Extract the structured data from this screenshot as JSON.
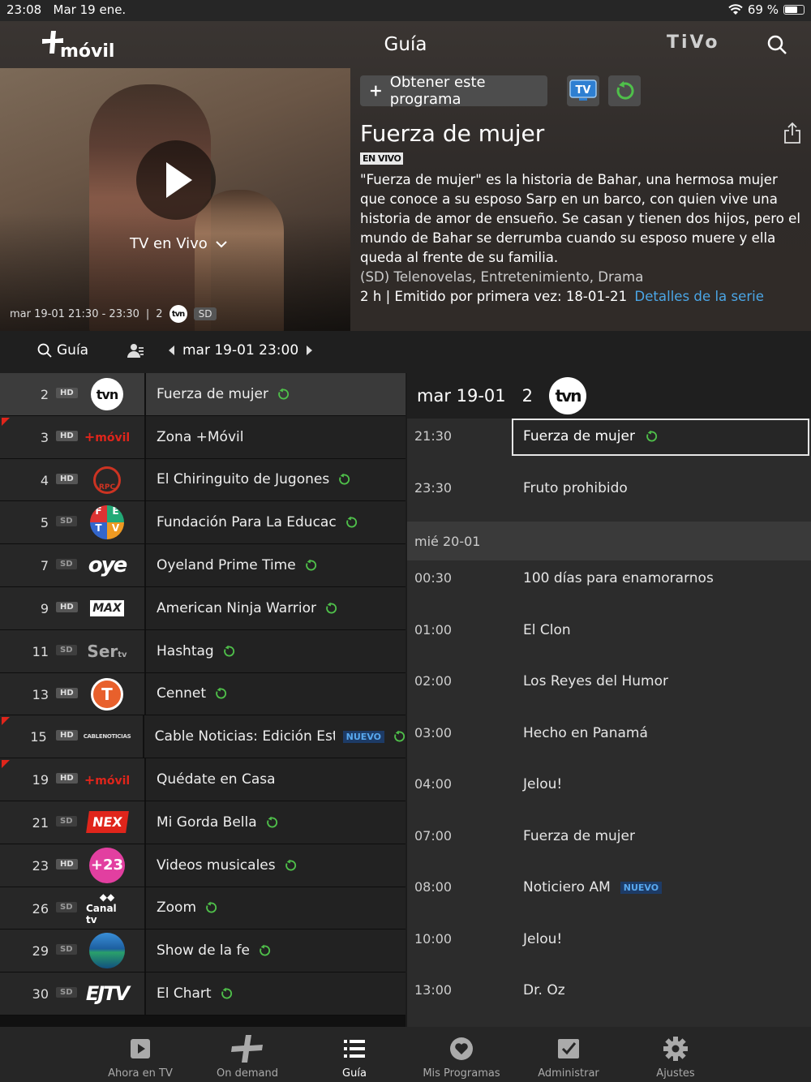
{
  "status_bar": {
    "time": "23:08",
    "date": "Mar 19 ene.",
    "battery": "69 %",
    "battery_level": 0.69
  },
  "header": {
    "logo_text": "+móvil",
    "title": "Guía",
    "brand": "TiVo"
  },
  "hero": {
    "play_label": "TV en Vivo",
    "airtime": "mar 19-01 21:30 - 23:30",
    "channel": "2",
    "channel_logo": "tvn",
    "quality": "SD"
  },
  "program": {
    "get_button": "Obtener este programa",
    "tv_button": "TV",
    "title": "Fuerza de mujer",
    "live_tag": "EN VIVO",
    "description": "\"Fuerza de mujer\" es la historia de Bahar, una hermosa mujer que conoce a su esposo Sarp en un barco, con quien vive una historia de amor de ensueño. Se casan y tienen dos hijos, pero el mundo de Bahar se derrumba cuando su esposo muere y ella queda al frente de su familia.",
    "genres": "(SD) Telenovelas, Entretenimiento, Drama",
    "meta": "2 h | Emitido por primera vez: 18-01-21",
    "series_link": "Detalles de la serie"
  },
  "filter": {
    "guide_label": "Guía",
    "date": "mar 19-01 23:00"
  },
  "channels": [
    {
      "num": "2",
      "q": "HD",
      "logo": "tvn",
      "program": "Fuerza de mujer",
      "restart": true,
      "nuevo": "",
      "corner": false,
      "selected": true
    },
    {
      "num": "3",
      "q": "HD",
      "logo": "+móvil",
      "program": "Zona +Móvil",
      "restart": false,
      "nuevo": "",
      "corner": true,
      "selected": false
    },
    {
      "num": "4",
      "q": "HD",
      "logo": "RPC",
      "program": "El Chiringuito de Jugones",
      "restart": true,
      "nuevo": "",
      "corner": false,
      "selected": false
    },
    {
      "num": "5",
      "q": "SD",
      "logo": "FETV",
      "program": "Fundación Para La Educación",
      "restart": true,
      "nuevo": "",
      "corner": false,
      "selected": false
    },
    {
      "num": "7",
      "q": "SD",
      "logo": "oye",
      "program": "Oyeland Prime Time",
      "restart": true,
      "nuevo": "",
      "corner": false,
      "selected": false
    },
    {
      "num": "9",
      "q": "HD",
      "logo": "TVMAX",
      "program": "American Ninja Warrior",
      "restart": true,
      "nuevo": "",
      "corner": false,
      "selected": false
    },
    {
      "num": "11",
      "q": "SD",
      "logo": "Sertv",
      "program": "Hashtag",
      "restart": true,
      "nuevo": "",
      "corner": false,
      "selected": false
    },
    {
      "num": "13",
      "q": "HD",
      "logo": "T",
      "program": "Cennet",
      "restart": true,
      "nuevo": "",
      "corner": false,
      "selected": false
    },
    {
      "num": "15",
      "q": "HD",
      "logo": "CABLENOTICIAS",
      "program": "Cable Noticias: Edición Estel",
      "restart": true,
      "nuevo": "NUEVO",
      "corner": true,
      "selected": false
    },
    {
      "num": "19",
      "q": "HD",
      "logo": "+móvil",
      "program": "Quédate en Casa",
      "restart": false,
      "nuevo": "",
      "corner": true,
      "selected": false
    },
    {
      "num": "21",
      "q": "SD",
      "logo": "NEX",
      "program": "Mi Gorda Bella",
      "restart": true,
      "nuevo": "",
      "corner": false,
      "selected": false
    },
    {
      "num": "23",
      "q": "HD",
      "logo": "+23",
      "program": "Videos musicales",
      "restart": true,
      "nuevo": "",
      "corner": false,
      "selected": false
    },
    {
      "num": "26",
      "q": "SD",
      "logo": "Canal tv",
      "program": "Zoom",
      "restart": true,
      "nuevo": "",
      "corner": false,
      "selected": false
    },
    {
      "num": "29",
      "q": "SD",
      "logo": "globe",
      "program": "Show de la fe",
      "restart": true,
      "nuevo": "",
      "corner": false,
      "selected": false
    },
    {
      "num": "30",
      "q": "SD",
      "logo": "EJTV",
      "program": "El Chart",
      "restart": true,
      "nuevo": "",
      "corner": false,
      "selected": false
    }
  ],
  "schedule": {
    "date": "mar 19-01",
    "channel": "2",
    "channel_logo": "tvn",
    "next_day": "mié 20-01",
    "today": [
      {
        "time": "21:30",
        "program": "Fuerza de mujer",
        "restart": true,
        "nuevo": "",
        "current": true
      },
      {
        "time": "23:30",
        "program": "Fruto prohibido",
        "restart": false,
        "nuevo": "",
        "current": false
      }
    ],
    "tomorrow": [
      {
        "time": "00:30",
        "program": "100 días para enamorarnos",
        "nuevo": ""
      },
      {
        "time": "01:00",
        "program": "El Clon",
        "nuevo": ""
      },
      {
        "time": "02:00",
        "program": "Los Reyes del Humor",
        "nuevo": ""
      },
      {
        "time": "03:00",
        "program": "Hecho en Panamá",
        "nuevo": ""
      },
      {
        "time": "04:00",
        "program": "Jelou!",
        "nuevo": ""
      },
      {
        "time": "07:00",
        "program": "Fuerza de mujer",
        "nuevo": ""
      },
      {
        "time": "08:00",
        "program": "Noticiero AM",
        "nuevo": "NUEVO"
      },
      {
        "time": "10:00",
        "program": "Jelou!",
        "nuevo": ""
      },
      {
        "time": "13:00",
        "program": "Dr. Oz",
        "nuevo": ""
      }
    ]
  },
  "tabs": [
    {
      "label": "Ahora en TV",
      "icon": "play-square-icon",
      "active": false
    },
    {
      "label": "On demand",
      "icon": "plus-icon",
      "active": false
    },
    {
      "label": "Guía",
      "icon": "list-icon",
      "active": true
    },
    {
      "label": "Mis Programas",
      "icon": "heart-icon",
      "active": false
    },
    {
      "label": "Administrar",
      "icon": "checkbox-icon",
      "active": false
    },
    {
      "label": "Ajustes",
      "icon": "gear-icon",
      "active": false
    }
  ],
  "colors": {
    "accent_link": "#4ba6e6",
    "restart_green": "#4fc04a",
    "tv_blue": "#2e7fd1",
    "nuevo_bg": "#1d3b66",
    "corner_red": "#e0251b"
  }
}
